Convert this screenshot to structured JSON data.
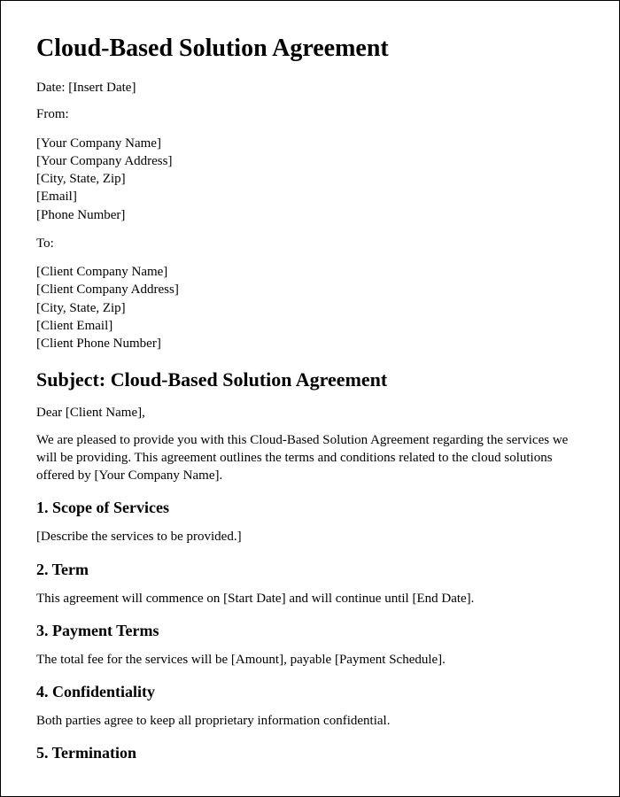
{
  "title": "Cloud-Based Solution Agreement",
  "date_line": "Date: [Insert Date]",
  "from_label": "From:",
  "from": {
    "company": "[Your Company Name]",
    "address": "[Your Company Address]",
    "city": "[City, State, Zip]",
    "email": "[Email]",
    "phone": "[Phone Number]"
  },
  "to_label": "To:",
  "to": {
    "company": "[Client Company Name]",
    "address": "[Client Company Address]",
    "city": "[City, State, Zip]",
    "email": "[Client Email]",
    "phone": "[Client Phone Number]"
  },
  "subject_heading": "Subject: Cloud-Based Solution Agreement",
  "salutation": "Dear [Client Name],",
  "intro": "We are pleased to provide you with this Cloud-Based Solution Agreement regarding the services we will be providing. This agreement outlines the terms and conditions related to the cloud solutions offered by [Your Company Name].",
  "sections": {
    "s1": {
      "heading": "1. Scope of Services",
      "body": "[Describe the services to be provided.]"
    },
    "s2": {
      "heading": "2. Term",
      "body": "This agreement will commence on [Start Date] and will continue until [End Date]."
    },
    "s3": {
      "heading": "3. Payment Terms",
      "body": "The total fee for the services will be [Amount], payable [Payment Schedule]."
    },
    "s4": {
      "heading": "4. Confidentiality",
      "body": "Both parties agree to keep all proprietary information confidential."
    },
    "s5": {
      "heading": "5. Termination"
    }
  }
}
